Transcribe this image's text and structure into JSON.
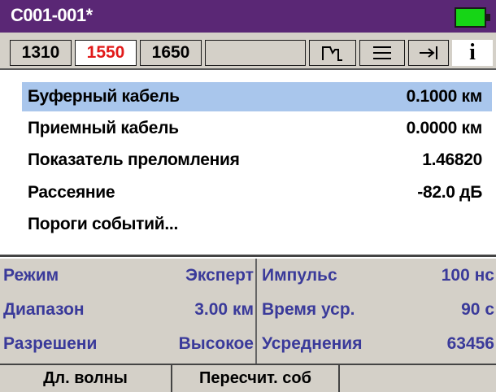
{
  "window": {
    "title": "C001-001*",
    "battery_color": "#16d516"
  },
  "tabs": [
    {
      "label": "1310",
      "active": false
    },
    {
      "label": "1550",
      "active": true
    },
    {
      "label": "1650",
      "active": false
    }
  ],
  "toolbar": {
    "icons": [
      "trace-marker-icon",
      "menu-lines-icon",
      "arrow-to-bar-icon",
      "info-icon"
    ],
    "info_label": "i"
  },
  "parameters": [
    {
      "label": "Буферный кабель",
      "value": "0.1000 км",
      "selected": true
    },
    {
      "label": "Приемный кабель",
      "value": "0.0000 км",
      "selected": false
    },
    {
      "label": "Показатель преломления",
      "value": "1.46820",
      "selected": false
    },
    {
      "label": "Рассеяние",
      "value": "-82.0 дБ",
      "selected": false
    },
    {
      "label": "Пороги событий...",
      "value": "",
      "selected": false
    }
  ],
  "info_left": [
    {
      "key": "Режим",
      "value": "Эксперт"
    },
    {
      "key": "Диапазон",
      "value": "3.00 км"
    },
    {
      "key": "Разрешени",
      "value": "Высокое"
    }
  ],
  "info_right": [
    {
      "key": "Импульс",
      "value": "100 нс"
    },
    {
      "key": "Время уср.",
      "value": "90 с"
    },
    {
      "key": "Усреднения",
      "value": "63456"
    }
  ],
  "softkeys": [
    {
      "label": "Дл. волны"
    },
    {
      "label": "Пересчит. соб"
    },
    {
      "label": ""
    }
  ],
  "colors": {
    "titlebar": "#5a2775",
    "active_tab_text": "#e11a1a",
    "selection": "#a9c6ec",
    "info_text": "#3a3a9a"
  }
}
